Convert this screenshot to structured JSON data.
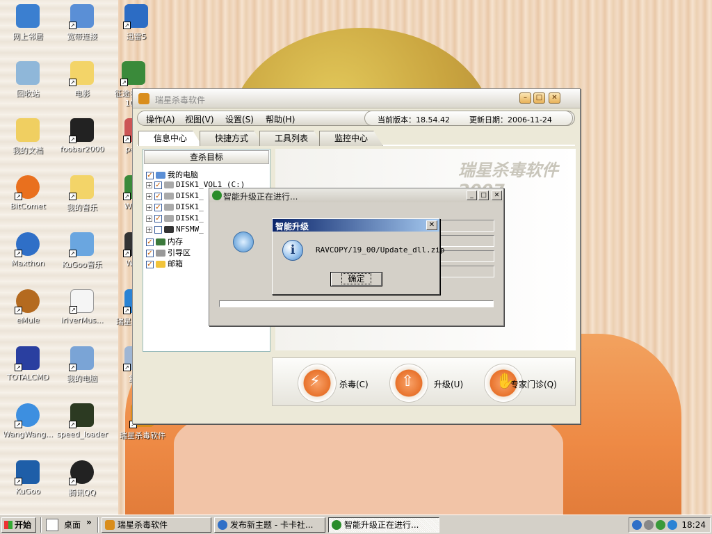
{
  "desktop": {
    "icons": [
      {
        "label": "网上邻居",
        "icon": "network-icon"
      },
      {
        "label": "宽带连接",
        "icon": "broadband-icon"
      },
      {
        "label": "迅雷5",
        "icon": "thunder-icon"
      },
      {
        "label": "回收站",
        "icon": "recycle-bin-icon"
      },
      {
        "label": "电影",
        "icon": "folder-icon"
      },
      {
        "label": "征途参数更 10...",
        "icon": "tree-icon"
      },
      {
        "label": "我的文档",
        "icon": "my-documents-icon"
      },
      {
        "label": "foobar2000",
        "icon": "foobar-icon"
      },
      {
        "label": "patch",
        "icon": "patch-icon"
      },
      {
        "label": "BitComet",
        "icon": "bitcomet-icon"
      },
      {
        "label": "我的音乐",
        "icon": "folder-icon"
      },
      {
        "label": "WDG4",
        "icon": "tree-icon"
      },
      {
        "label": "Maxthon",
        "icon": "maxthon-icon"
      },
      {
        "label": "KuGoo音乐",
        "icon": "kugoo-music-icon"
      },
      {
        "label": "WinM",
        "icon": "winm-icon"
      },
      {
        "label": "eMule",
        "icon": "emule-icon"
      },
      {
        "label": "iriverMus...",
        "icon": "iriver-icon"
      },
      {
        "label": "瑞星杀 安全",
        "icon": "rising-icon"
      },
      {
        "label": "TOTALCMD",
        "icon": "totalcmd-icon"
      },
      {
        "label": "我的电脑",
        "icon": "my-computer-icon"
      },
      {
        "label": "复件",
        "icon": "copy-icon"
      },
      {
        "label": "WangWang...",
        "icon": "wangwang-icon"
      },
      {
        "label": "speed_loader",
        "icon": "speed-loader-icon"
      },
      {
        "label": "瑞星杀毒软件",
        "icon": "rising-icon"
      },
      {
        "label": "KuGoo",
        "icon": "kugoo-icon"
      },
      {
        "label": "腾讯QQ",
        "icon": "qq-icon"
      }
    ]
  },
  "main_window": {
    "menu": [
      "操作(A)",
      "视图(V)",
      "设置(S)",
      "帮助(H)"
    ],
    "version_label": "当前版本：18.54.42",
    "date_label": "更新日期：2006-11-24",
    "tabs": [
      "信息中心",
      "快捷方式",
      "工具列表",
      "监控中心"
    ],
    "scan_target": "查杀目标",
    "tree": [
      {
        "label": "我的电脑",
        "checked": true
      },
      {
        "label": "DISK1_VOL1 (C:)",
        "checked": true
      },
      {
        "label": "DISK1_",
        "checked": true
      },
      {
        "label": "DISK1_",
        "checked": true
      },
      {
        "label": "DISK1_",
        "checked": true
      },
      {
        "label": "NFSMW_",
        "checked": false
      },
      {
        "label": "内存",
        "checked": true
      },
      {
        "label": "引导区",
        "checked": true
      },
      {
        "label": "邮箱",
        "checked": true
      }
    ],
    "brand": "瑞星杀毒软件",
    "brand_year": "2007",
    "actions": [
      {
        "label": "杀毒(C)",
        "icon": "antivirus-icon"
      },
      {
        "label": "升级(U)",
        "icon": "upgrade-icon"
      },
      {
        "label": "专家门诊(Q)",
        "icon": "expert-clinic-icon"
      }
    ]
  },
  "upgrade_window": {
    "title": "智能升级正在进行..."
  },
  "message_box": {
    "title": "智能升级",
    "text": "RAVCOPY/19_00/Update_dll.zip",
    "ok_label": "确定"
  },
  "taskbar": {
    "start_label": "开始",
    "desktop_label": "桌面",
    "tasks": [
      {
        "label": "瑞星杀毒软件",
        "active": false
      },
      {
        "label": "发布新主题 - 卡卡社...",
        "active": false
      },
      {
        "label": "智能升级正在进行...",
        "active": true
      }
    ],
    "clock": "18:24"
  }
}
